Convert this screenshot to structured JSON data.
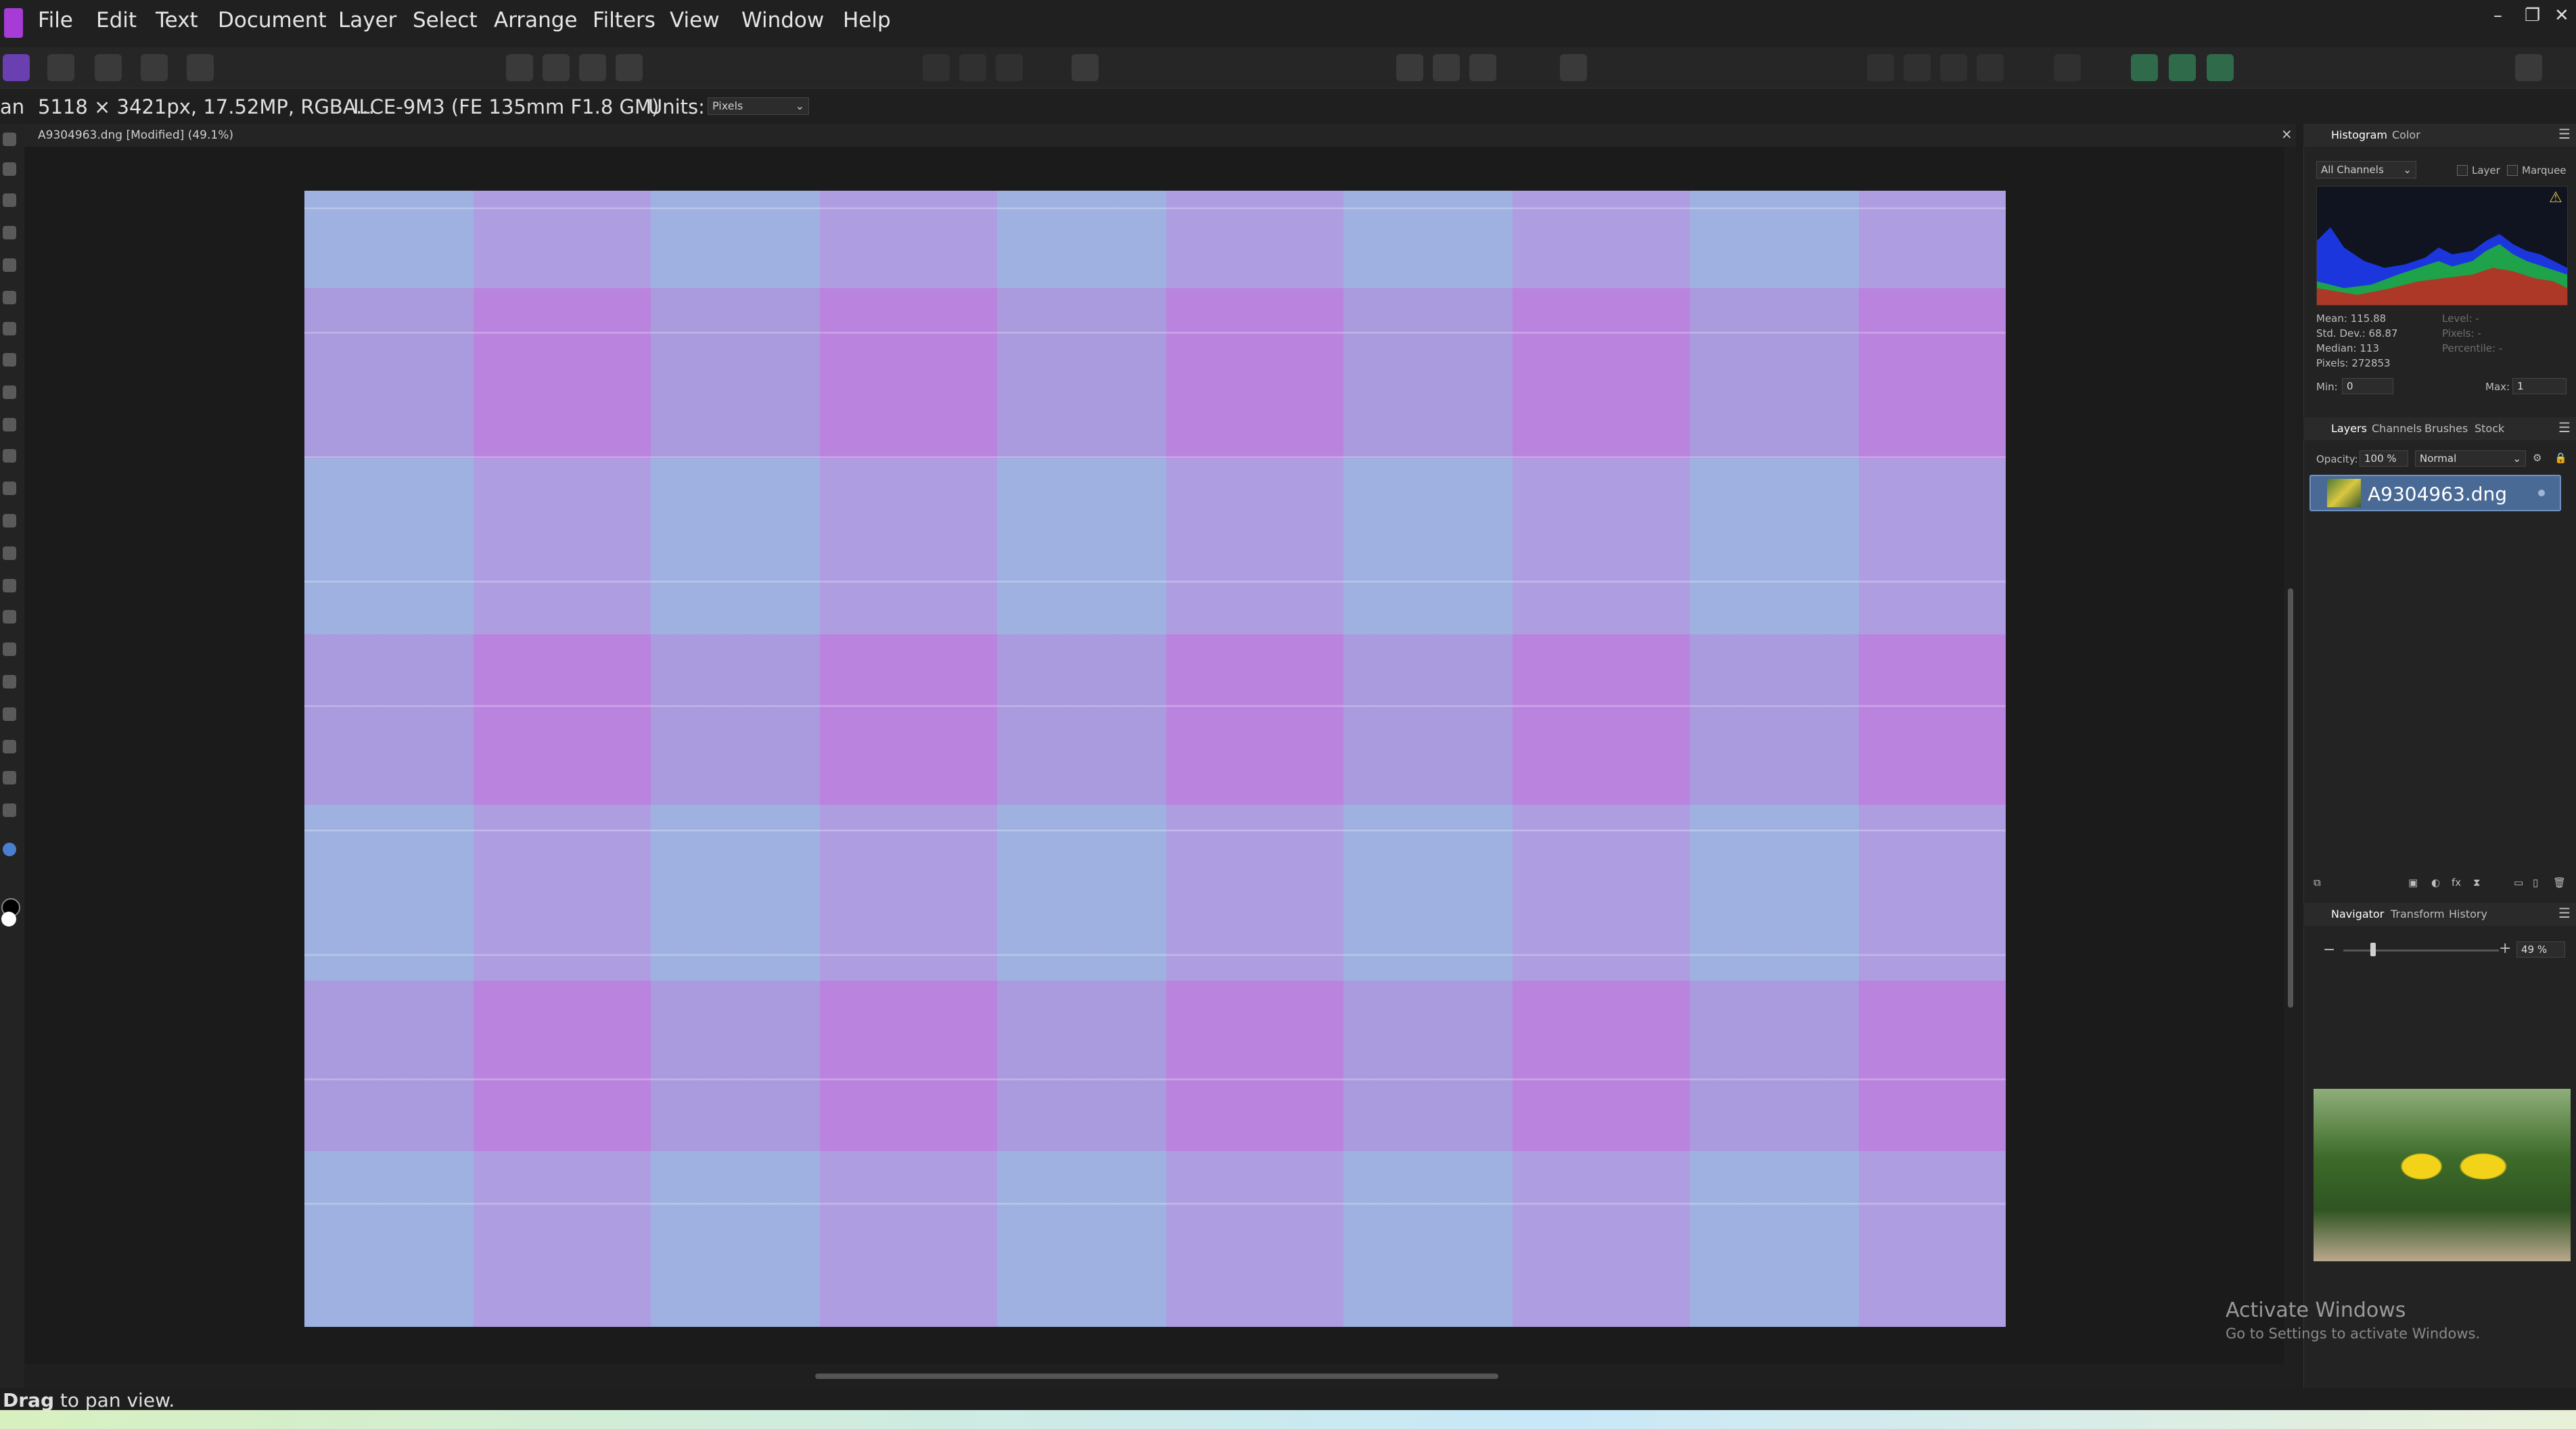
{
  "menu": [
    "File",
    "Edit",
    "Text",
    "Document",
    "Layer",
    "Select",
    "Arrange",
    "Filters",
    "View",
    "Window",
    "Help"
  ],
  "context": {
    "tool_abbrev": "an",
    "image_info": "5118 × 3421px, 17.52MP, RGBA...",
    "camera": "ILCE-9M3 (FE 135mm F1.8 GM)",
    "units_label": "Units:",
    "units_value": "Pixels"
  },
  "document": {
    "tab_title": "A9304963.dng [Modified] (49.1%)",
    "close": "×"
  },
  "histogram": {
    "tabs": [
      "Histogram",
      "Color"
    ],
    "channel": "All Channels",
    "layer_label": "Layer",
    "marquee_label": "Marquee",
    "stats_left": [
      "Mean: 115.88",
      "Std. Dev.: 68.87",
      "Median: 113",
      "Pixels: 272853"
    ],
    "stats_right": [
      "Level: -",
      "Pixels: -",
      "Percentile: -"
    ],
    "min_label": "Min:",
    "min_value": "0",
    "max_label": "Max:",
    "max_value": "1"
  },
  "layers": {
    "tabs": [
      "Layers",
      "Channels",
      "Brushes",
      "Stock"
    ],
    "opacity_label": "Opacity:",
    "opacity_value": "100 %",
    "blend_mode": "Normal",
    "items": [
      {
        "name": "A9304963.dng"
      }
    ]
  },
  "navigator": {
    "tabs": [
      "Navigator",
      "Transform",
      "History"
    ],
    "zoom": "49 %"
  },
  "status": {
    "bold": "Drag",
    "rest": " to pan view."
  },
  "watermark": {
    "title": "Activate Windows",
    "subtitle": "Go to Settings to activate Windows."
  },
  "colors": {
    "accent": "#a63bd6",
    "layer_selected": "#4a6a96",
    "canvas_tint": "#b48fe0"
  }
}
